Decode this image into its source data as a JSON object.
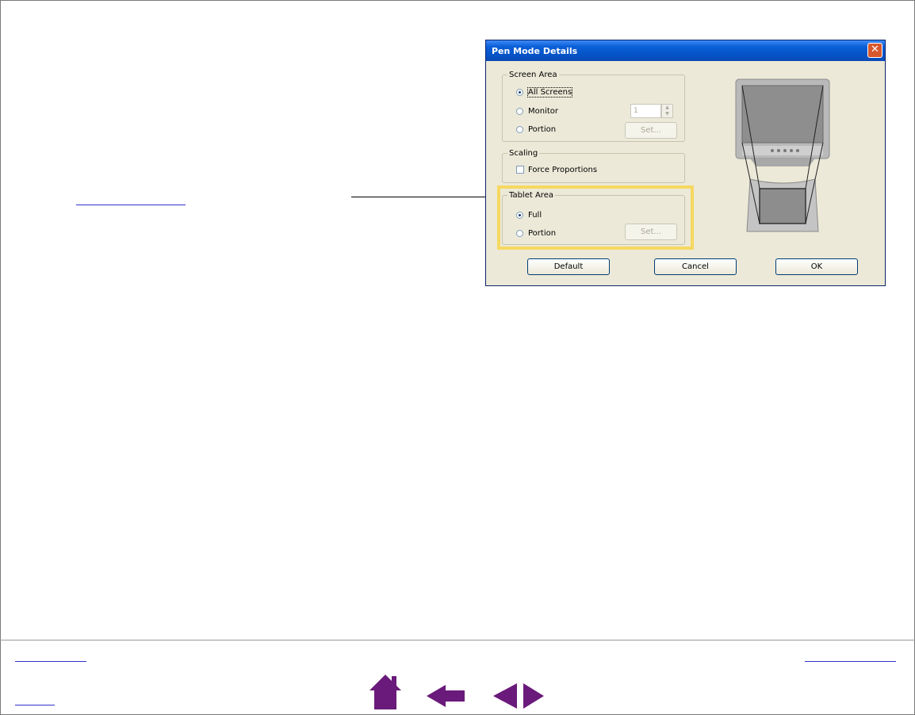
{
  "dialog": {
    "title": "Pen Mode Details",
    "close_glyph": "✕",
    "screen_area": {
      "legend": "Screen Area",
      "options": [
        "All Screens",
        "Monitor",
        "Portion"
      ],
      "selected": "All Screens",
      "monitor_value": "1",
      "set_label": "Set..."
    },
    "scaling": {
      "legend": "Scaling",
      "force_proportions_label": "Force Proportions",
      "force_proportions_checked": false
    },
    "tablet_area": {
      "legend": "Tablet Area",
      "options": [
        "Full",
        "Portion"
      ],
      "selected": "Full",
      "set_label": "Set..."
    },
    "buttons": {
      "default": "Default",
      "cancel": "Cancel",
      "ok": "OK"
    }
  },
  "icons": {
    "home": "home-icon",
    "back": "back-arrow-icon",
    "prev": "previous-page-icon",
    "next": "next-page-icon"
  },
  "colors": {
    "highlight": "#f6d860",
    "nav_icon": "#6a1a7a",
    "link": "#3333cc"
  }
}
